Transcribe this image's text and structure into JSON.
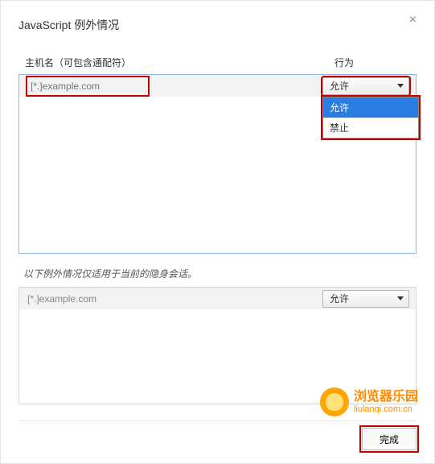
{
  "dialog": {
    "title": "JavaScript 例外情况",
    "close": "×"
  },
  "columns": {
    "hostname": "主机名（可包含通配符）",
    "behavior": "行为"
  },
  "main": {
    "host_placeholder": "[*.]example.com",
    "selected_behavior": "允许",
    "options": [
      "允许",
      "禁止"
    ]
  },
  "incognito": {
    "note": "以下例外情况仅适用于当前的隐身会话。",
    "host_placeholder": "[*.]example.com",
    "selected_behavior": "允许"
  },
  "watermark": {
    "cn": "浏览器乐园",
    "en": "liulanqi.com.cn"
  },
  "footer": {
    "done": "完成"
  }
}
